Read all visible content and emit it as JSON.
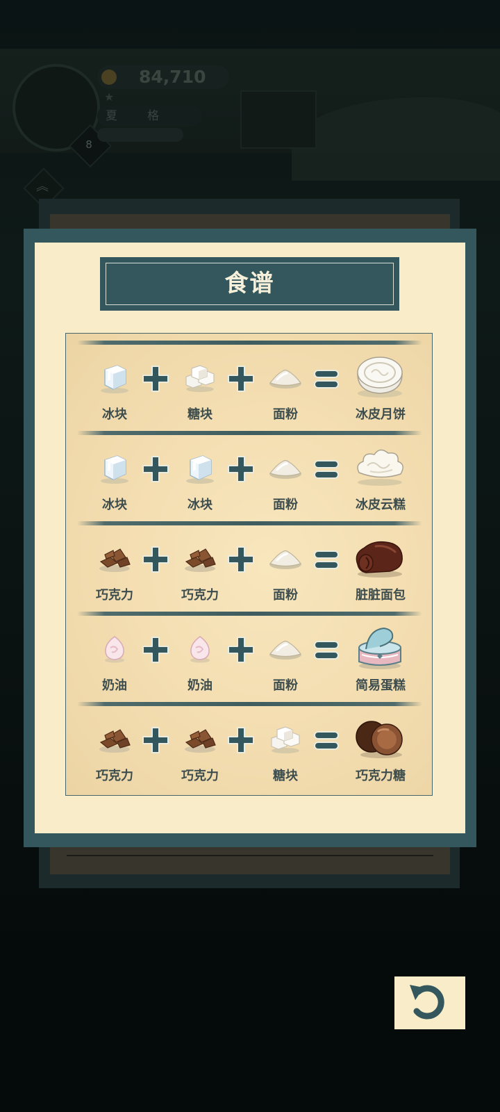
{
  "hud": {
    "coins": "84,710",
    "level": "8",
    "pill_left": "夏",
    "pill_right": "格",
    "sub_text": "",
    "chevron_glyph": "︽"
  },
  "modal": {
    "title": "食谱",
    "recipes": [
      {
        "ingredients": [
          {
            "name": "冰块",
            "icon": "ice-cube-icon"
          },
          {
            "name": "糖块",
            "icon": "sugar-cube-icon"
          },
          {
            "name": "面粉",
            "icon": "flour-pile-icon"
          }
        ],
        "result": {
          "name": "冰皮月饼",
          "icon": "snowskin-mooncake-icon"
        }
      },
      {
        "ingredients": [
          {
            "name": "冰块",
            "icon": "ice-cube-icon"
          },
          {
            "name": "冰块",
            "icon": "ice-cube-icon"
          },
          {
            "name": "面粉",
            "icon": "flour-pile-icon"
          }
        ],
        "result": {
          "name": "冰皮云糕",
          "icon": "snowskin-cloud-cake-icon"
        }
      },
      {
        "ingredients": [
          {
            "name": "巧克力",
            "icon": "chocolate-pieces-icon"
          },
          {
            "name": "巧克力",
            "icon": "chocolate-pieces-icon"
          },
          {
            "name": "面粉",
            "icon": "flour-pile-icon"
          }
        ],
        "result": {
          "name": "脏脏面包",
          "icon": "dirty-bread-icon"
        }
      },
      {
        "ingredients": [
          {
            "name": "奶油",
            "icon": "cream-icon"
          },
          {
            "name": "奶油",
            "icon": "cream-icon"
          },
          {
            "name": "面粉",
            "icon": "flour-pile-icon"
          }
        ],
        "result": {
          "name": "简易蛋糕",
          "icon": "simple-cake-icon"
        }
      },
      {
        "ingredients": [
          {
            "name": "巧克力",
            "icon": "chocolate-pieces-icon"
          },
          {
            "name": "巧克力",
            "icon": "chocolate-pieces-icon"
          },
          {
            "name": "糖块",
            "icon": "sugar-cube-icon"
          }
        ],
        "result": {
          "name": "巧克力糖",
          "icon": "chocolate-candy-icon"
        }
      }
    ]
  },
  "back_button": {
    "icon": "undo-arrow-icon"
  },
  "colors": {
    "teal": "#33575d",
    "paper": "#f9ecc9",
    "label": "#3d4d4e"
  }
}
